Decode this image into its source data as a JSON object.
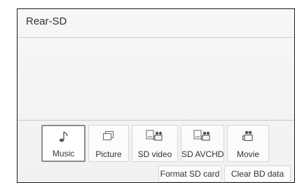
{
  "screen": {
    "title": "Rear-SD"
  },
  "sources": [
    {
      "label": "Music",
      "icon": "music-note-icon",
      "selected": true
    },
    {
      "label": "Picture",
      "icon": "picture-icon",
      "selected": false
    },
    {
      "label": "SD video",
      "icon": "sd-video-icon",
      "selected": false
    },
    {
      "label": "SD AVCHD",
      "icon": "sd-avchd-icon",
      "selected": false
    },
    {
      "label": "Movie",
      "icon": "movie-icon",
      "selected": false
    }
  ],
  "actions": {
    "format_label": "Format SD card",
    "clear_label": "Clear BD data"
  }
}
